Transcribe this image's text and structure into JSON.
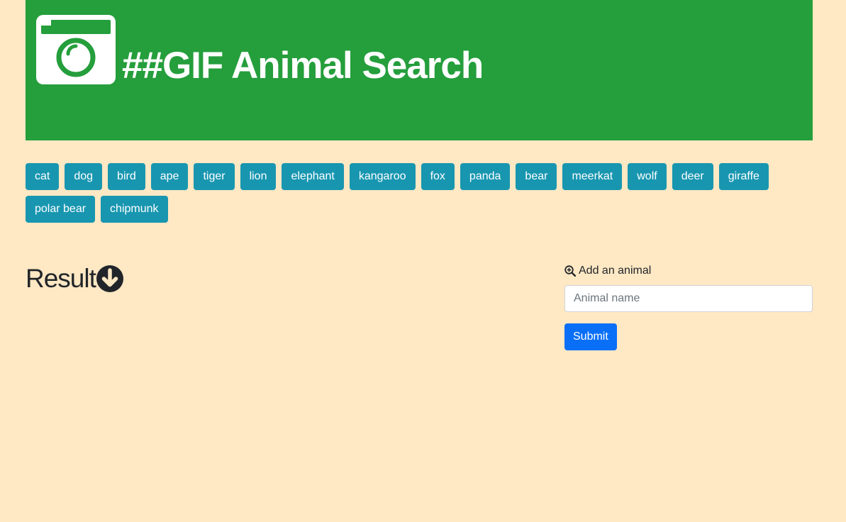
{
  "header": {
    "title": "##GIF Animal Search",
    "icon": "camera-window-icon",
    "background_color": "#259e3c"
  },
  "animal_buttons": {
    "color": "#1896b0",
    "labels": [
      "cat",
      "dog",
      "bird",
      "ape",
      "tiger",
      "lion",
      "elephant",
      "kangaroo",
      "fox",
      "panda",
      "bear",
      "meerkat",
      "wolf",
      "deer",
      "giraffe",
      "polar bear",
      "chipmunk"
    ]
  },
  "result": {
    "heading": "Result",
    "icon": "arrow-circle-down-icon"
  },
  "add_form": {
    "icon": "zoom-in-icon",
    "label": "Add an animal",
    "input_placeholder": "Animal name",
    "input_value": "",
    "submit_label": "Submit",
    "submit_color": "#0a6ff7"
  },
  "page": {
    "background_color": "#ffe8c4"
  }
}
